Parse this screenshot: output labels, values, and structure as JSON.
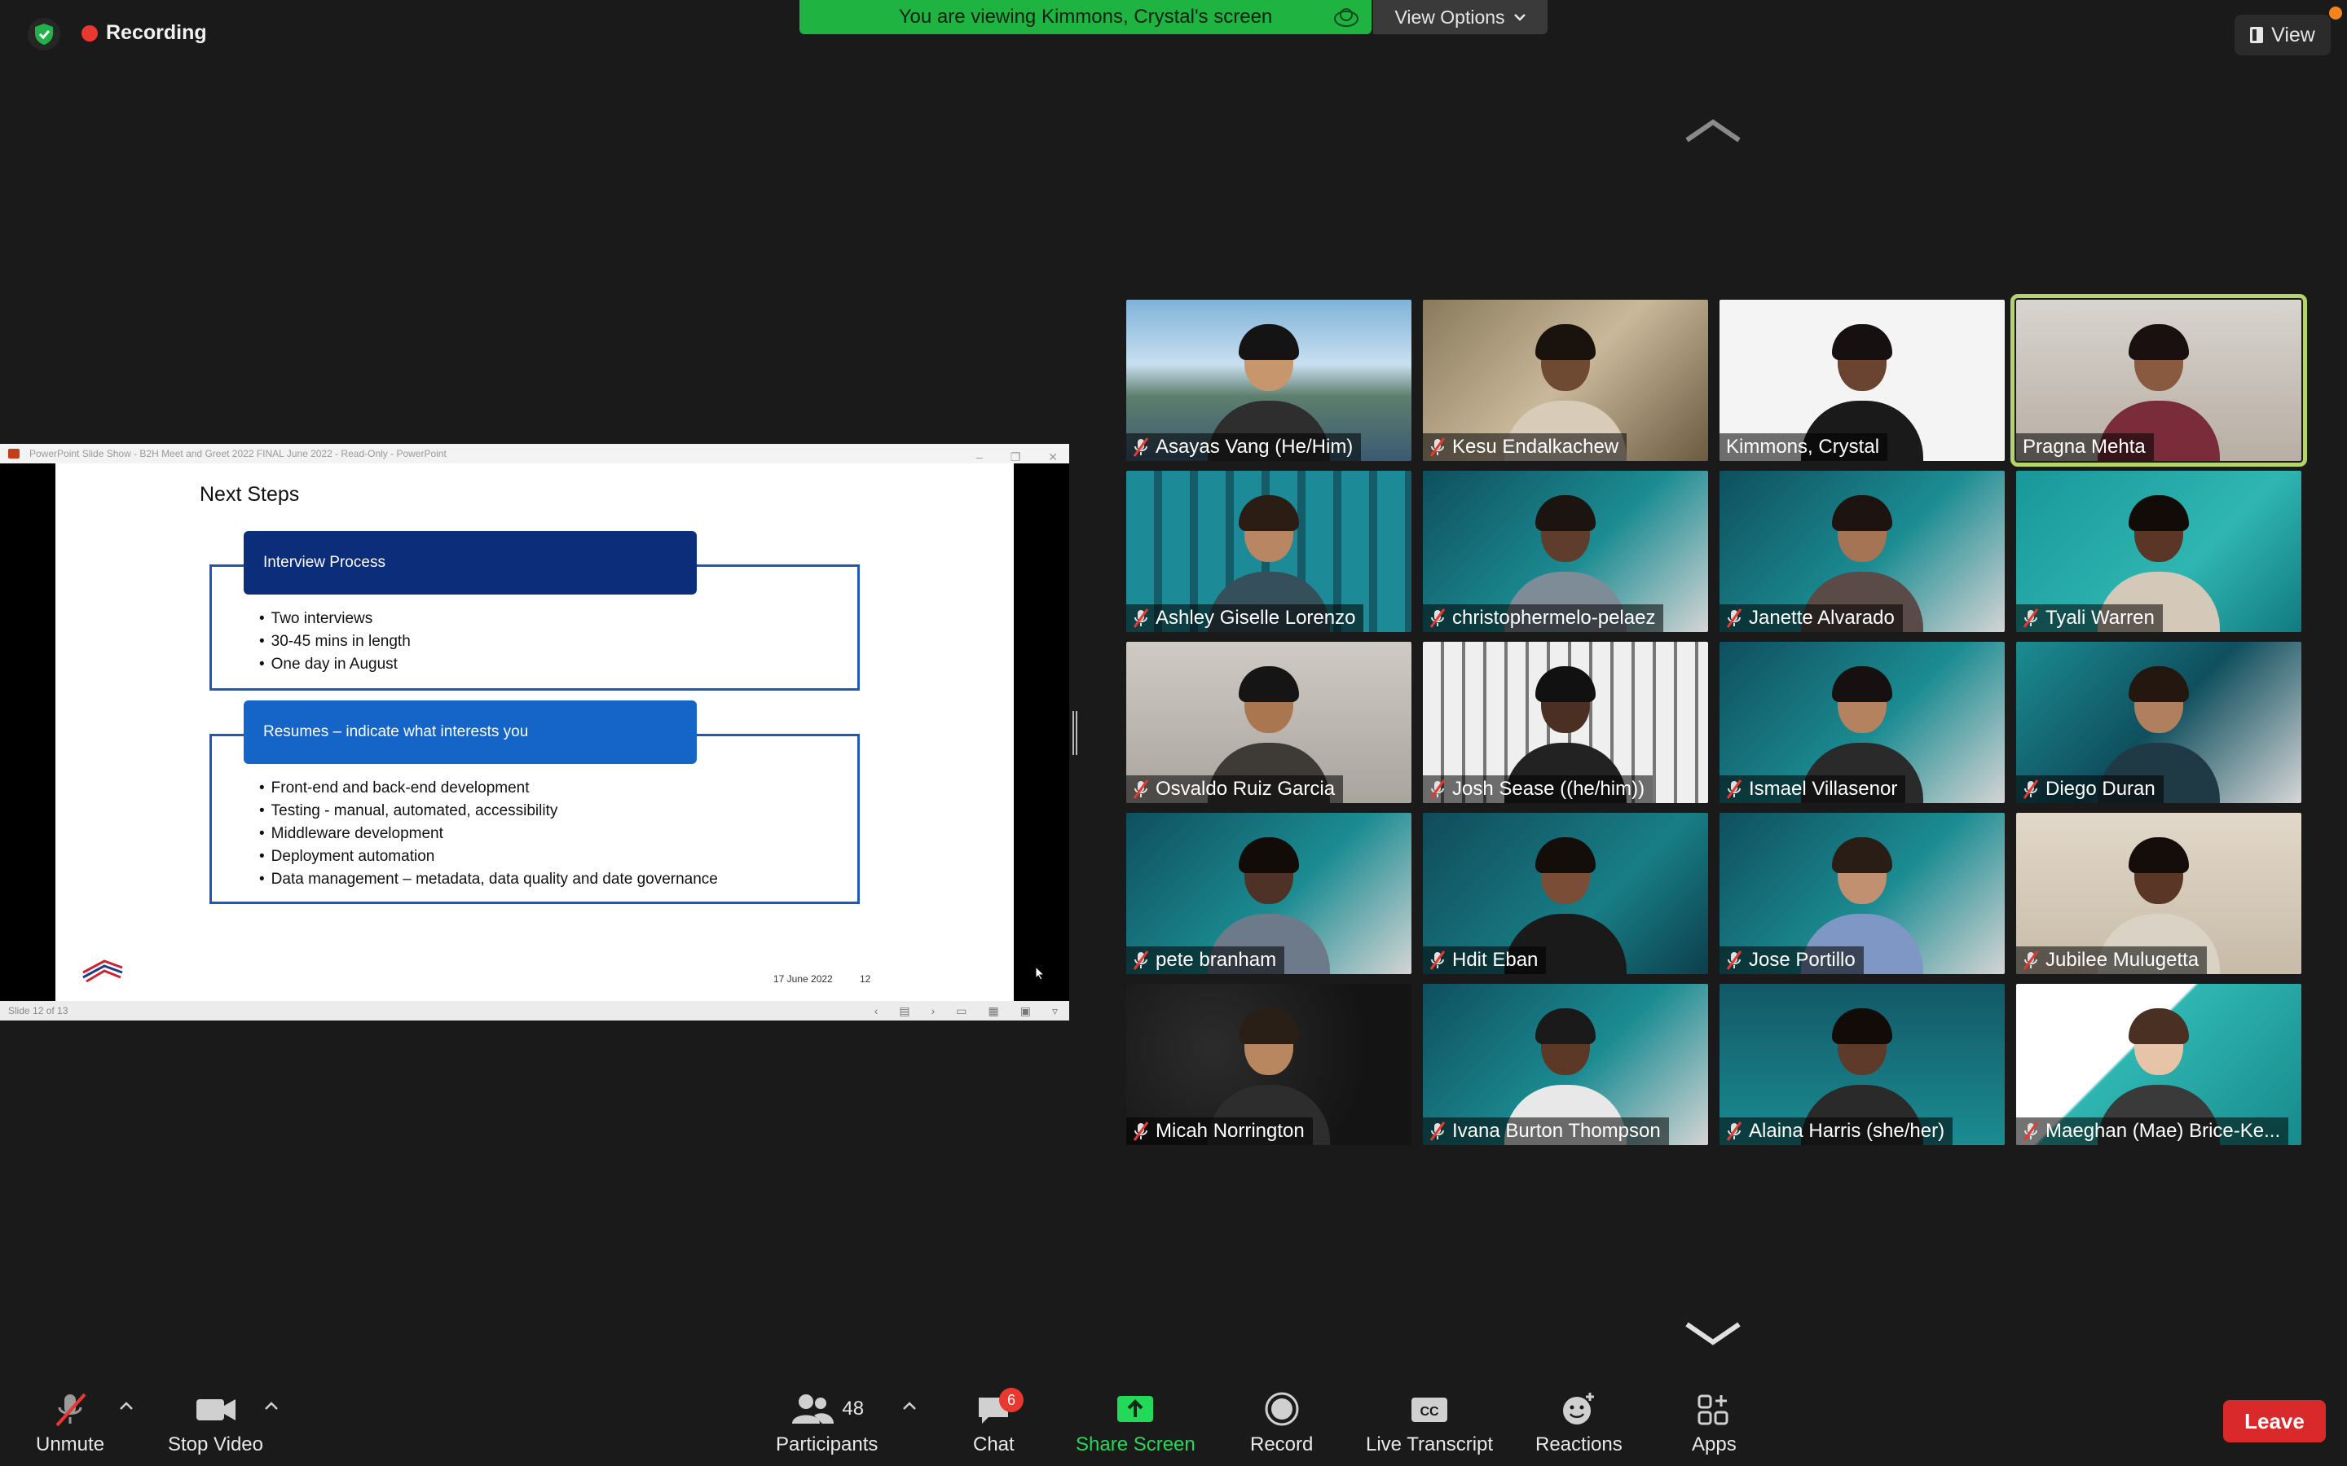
{
  "topbar": {
    "recording_label": "Recording",
    "banner_text": "You are viewing Kimmons, Crystal's screen",
    "view_options_label": "View Options",
    "view_label": "View"
  },
  "share": {
    "window_title": "PowerPoint Slide Show  -  B2H Meet and Greet 2022 FINAL June 2022  -  Read-Only  -  PowerPoint",
    "status_text": "Slide 12 of 13",
    "slide": {
      "title": "Next Steps",
      "section1_header": "Interview Process",
      "section1_bullets": [
        "Two interviews",
        "30-45 mins in length",
        "One day in August"
      ],
      "section2_header": "Resumes – indicate what interests you",
      "section2_bullets": [
        "Front-end and back-end development",
        "Testing - manual, automated,  accessibility",
        "Middleware development",
        "Deployment automation",
        "Data management – metadata, data quality and date governance"
      ],
      "date": "17 June 2022",
      "page_number": "12"
    }
  },
  "participants": [
    {
      "name": "Asayas Vang  (He/Him)",
      "muted": true
    },
    {
      "name": "Kesu Endalkachew",
      "muted": true
    },
    {
      "name": "Kimmons, Crystal",
      "muted": false
    },
    {
      "name": "Pragna Mehta",
      "muted": false,
      "active_speaker": true
    },
    {
      "name": "Ashley Giselle Lorenzo",
      "muted": true
    },
    {
      "name": "christophermelo-pelaez",
      "muted": true
    },
    {
      "name": "Janette Alvarado",
      "muted": true
    },
    {
      "name": "Tyali Warren",
      "muted": true
    },
    {
      "name": "Osvaldo Ruiz Garcia",
      "muted": true
    },
    {
      "name": "Josh Sease  ((he/him))",
      "muted": true
    },
    {
      "name": "Ismael Villasenor",
      "muted": true
    },
    {
      "name": "Diego Duran",
      "muted": true
    },
    {
      "name": "pete branham",
      "muted": true
    },
    {
      "name": "Hdit Eban",
      "muted": true
    },
    {
      "name": "Jose Portillo",
      "muted": true
    },
    {
      "name": "Jubilee Mulugetta",
      "muted": true
    },
    {
      "name": "Micah Norrington",
      "muted": true
    },
    {
      "name": "Ivana Burton Thompson",
      "muted": true
    },
    {
      "name": "Alaina Harris  (she/her)",
      "muted": true
    },
    {
      "name": "Maeghan (Mae) Brice-Ke...",
      "muted": true
    }
  ],
  "toolbar": {
    "unmute_label": "Unmute",
    "stop_video_label": "Stop Video",
    "participants_label": "Participants",
    "participants_count": "48",
    "chat_label": "Chat",
    "chat_badge": "6",
    "share_screen_label": "Share Screen",
    "record_label": "Record",
    "live_transcript_label": "Live Transcript",
    "reactions_label": "Reactions",
    "apps_label": "Apps",
    "leave_label": "Leave"
  },
  "colors": {
    "background": "#1a1a1a",
    "banner_green": "#1fb341",
    "leave_red": "#d9292b",
    "active_speaker": "#b5d36b",
    "share_screen_green": "#23d959",
    "slide_dark_blue": "#0c2d79",
    "slide_blue": "#1565c9"
  }
}
